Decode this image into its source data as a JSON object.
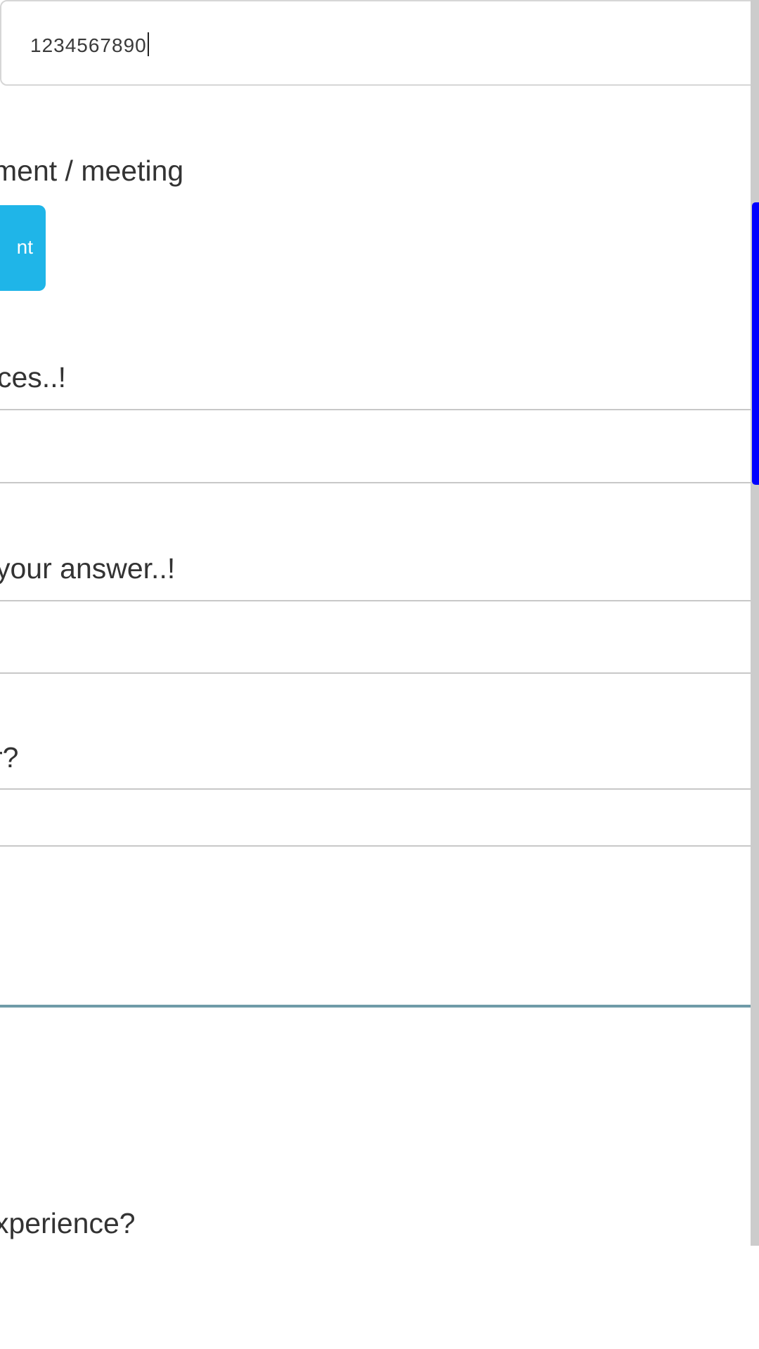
{
  "form": {
    "phone_value": "1234567890",
    "appointment_label": "ment / meeting",
    "appointment_button": "nt",
    "services_label": "ces..!",
    "answer_label": "your answer..!",
    "other_label": "r?",
    "experience_label": "xperience?"
  }
}
